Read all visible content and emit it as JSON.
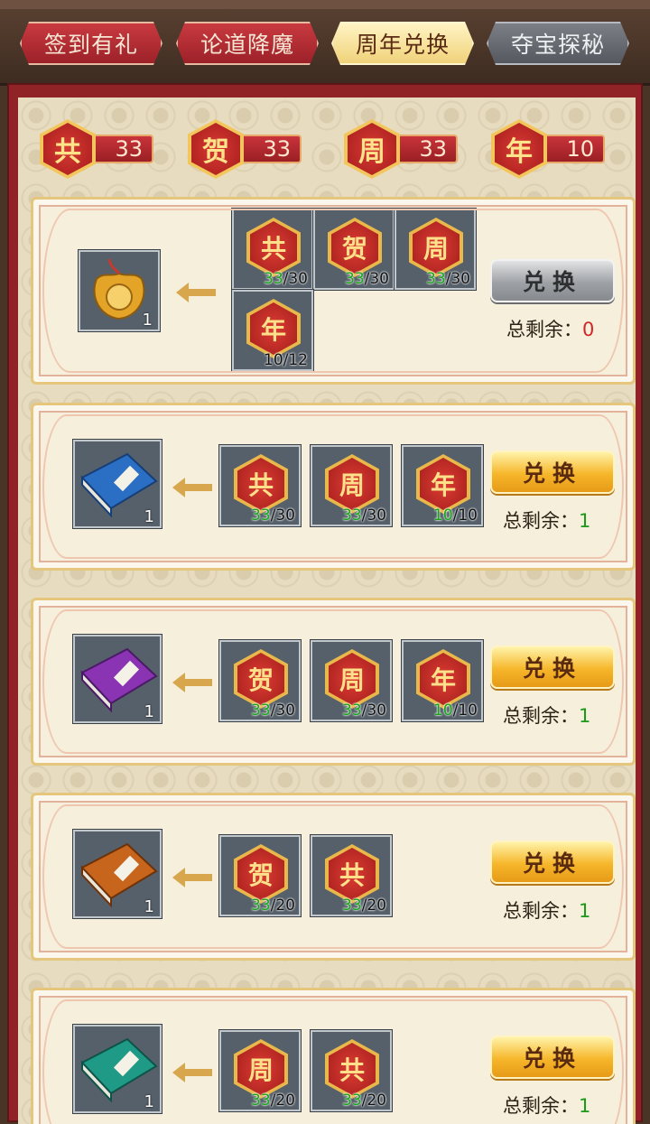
{
  "tabs": [
    {
      "label": "签到有礼",
      "state": "normal"
    },
    {
      "label": "论道降魔",
      "state": "normal"
    },
    {
      "label": "周年兑换",
      "state": "active"
    },
    {
      "label": "夺宝探秘",
      "state": "dim"
    }
  ],
  "currencies": [
    {
      "char": "共",
      "count": "33"
    },
    {
      "char": "贺",
      "count": "33"
    },
    {
      "char": "周",
      "count": "33"
    },
    {
      "char": "年",
      "count": "10"
    }
  ],
  "cards": [
    {
      "reward_icon": "gold-ornament-icon",
      "reward_qty": "1",
      "costs": [
        {
          "char": "共",
          "have": "33",
          "need": "/30"
        },
        {
          "char": "贺",
          "have": "33",
          "need": "/30"
        },
        {
          "char": "周",
          "have": "33",
          "need": "/30"
        },
        {
          "char": "年",
          "have": "10",
          "need": "/12"
        }
      ],
      "button_label": "兑换",
      "enabled": false,
      "remain_label": "总剩余：",
      "remain": "0"
    },
    {
      "reward_icon": "blue-book-icon",
      "reward_qty": "1",
      "costs": [
        {
          "char": "共",
          "have": "33",
          "need": "/30"
        },
        {
          "char": "周",
          "have": "33",
          "need": "/30"
        },
        {
          "char": "年",
          "have": "10",
          "need": "/10"
        }
      ],
      "button_label": "兑换",
      "enabled": true,
      "remain_label": "总剩余：",
      "remain": "1"
    },
    {
      "reward_icon": "purple-book-icon",
      "reward_qty": "1",
      "costs": [
        {
          "char": "贺",
          "have": "33",
          "need": "/30"
        },
        {
          "char": "周",
          "have": "33",
          "need": "/30"
        },
        {
          "char": "年",
          "have": "10",
          "need": "/10"
        }
      ],
      "button_label": "兑换",
      "enabled": true,
      "remain_label": "总剩余：",
      "remain": "1"
    },
    {
      "reward_icon": "orange-book-icon",
      "reward_qty": "1",
      "costs": [
        {
          "char": "贺",
          "have": "33",
          "need": "/20"
        },
        {
          "char": "共",
          "have": "33",
          "need": "/20"
        }
      ],
      "button_label": "兑换",
      "enabled": true,
      "remain_label": "总剩余：",
      "remain": "1"
    },
    {
      "reward_icon": "green-book-icon",
      "reward_qty": "1",
      "costs": [
        {
          "char": "周",
          "have": "33",
          "need": "/20"
        },
        {
          "char": "共",
          "have": "33",
          "need": "/20"
        }
      ],
      "button_label": "兑换",
      "enabled": true,
      "remain_label": "总剩余：",
      "remain": "1"
    }
  ],
  "colors": {
    "have": "#17a418",
    "remain_zero": "#d12626",
    "remain_ok": "#1a9a18",
    "frame": "#8f2326"
  }
}
